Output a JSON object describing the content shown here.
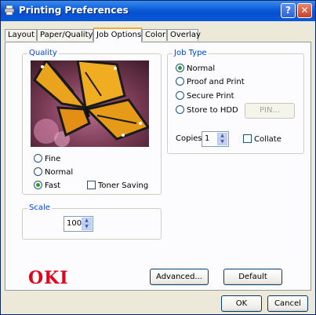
{
  "window": {
    "title": "Printing Preferences",
    "help_label": "?",
    "close_label": "✕"
  },
  "tabs": [
    {
      "label": "Layout"
    },
    {
      "label": "Paper/Quality"
    },
    {
      "label": "Job Options",
      "active": true
    },
    {
      "label": "Color"
    },
    {
      "label": "Overlay"
    }
  ],
  "quality": {
    "legend": "Quality",
    "options": [
      {
        "label": "Fine",
        "selected": false
      },
      {
        "label": "Normal",
        "selected": false
      },
      {
        "label": "Fast",
        "selected": true
      }
    ],
    "toner_saving": {
      "label": "Toner Saving",
      "checked": false
    }
  },
  "scale": {
    "legend": "Scale",
    "value": "100"
  },
  "job_type": {
    "legend": "Job Type",
    "options": [
      {
        "label": "Normal",
        "selected": true
      },
      {
        "label": "Proof and Print",
        "selected": false
      },
      {
        "label": "Secure Print",
        "selected": false
      },
      {
        "label": "Store to HDD",
        "selected": false
      }
    ],
    "pin_button": "PIN...",
    "copies_label": "Copies",
    "copies_value": "1",
    "collate": {
      "label": "Collate",
      "checked": false
    }
  },
  "brand": {
    "logo_text": "OKI",
    "color": "#e3001b"
  },
  "buttons": {
    "advanced": "Advanced...",
    "default": "Default",
    "ok": "OK",
    "cancel": "Cancel"
  },
  "colors": {
    "titlebar": "#0651cf",
    "accent_legend": "#0046d5",
    "tab_highlight": "#f1a93a"
  }
}
